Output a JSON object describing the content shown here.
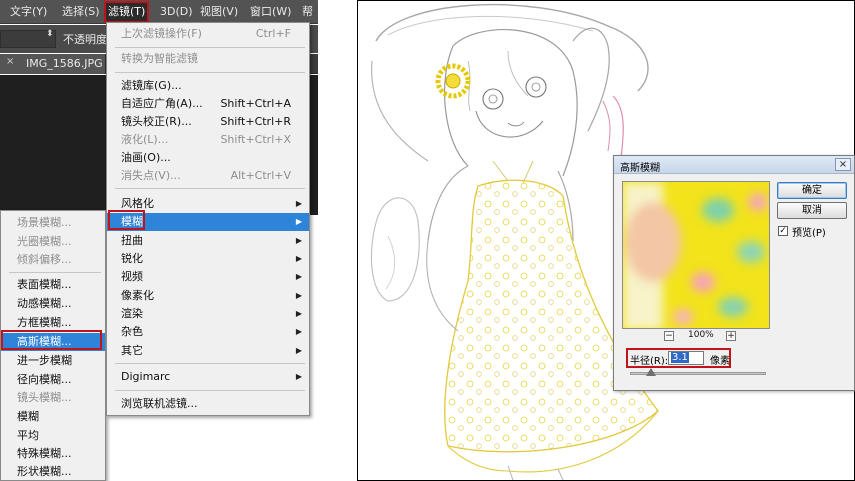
{
  "menubar": {
    "items": [
      "文字(Y)",
      "选择(S)",
      "滤镜(T)",
      "3D(D)",
      "视图(V)",
      "窗口(W)",
      "帮"
    ]
  },
  "options_bar": {
    "opacity_label": "不透明度"
  },
  "document_tab": {
    "close_glyph": "×",
    "title": "IMG_1586.JPG"
  },
  "filter_menu": {
    "items": [
      {
        "label": "上次滤镜操作(F)",
        "shortcut": "Ctrl+F",
        "disabled": true
      },
      {
        "label": "转换为智能滤镜",
        "shortcut": "",
        "disabled": true
      },
      {
        "label": "滤镜库(G)...",
        "shortcut": "",
        "disabled": false
      },
      {
        "label": "自适应广角(A)...",
        "shortcut": "Shift+Ctrl+A",
        "disabled": false
      },
      {
        "label": "镜头校正(R)...",
        "shortcut": "Shift+Ctrl+R",
        "disabled": false
      },
      {
        "label": "液化(L)...",
        "shortcut": "Shift+Ctrl+X",
        "disabled": true
      },
      {
        "label": "油画(O)...",
        "shortcut": "",
        "disabled": false
      },
      {
        "label": "消失点(V)...",
        "shortcut": "Alt+Ctrl+V",
        "disabled": true
      },
      {
        "label": "风格化",
        "shortcut": "",
        "disabled": false
      },
      {
        "label": "模糊",
        "shortcut": "",
        "disabled": false
      },
      {
        "label": "扭曲",
        "shortcut": "",
        "disabled": false
      },
      {
        "label": "锐化",
        "shortcut": "",
        "disabled": false
      },
      {
        "label": "视频",
        "shortcut": "",
        "disabled": false
      },
      {
        "label": "像素化",
        "shortcut": "",
        "disabled": false
      },
      {
        "label": "渲染",
        "shortcut": "",
        "disabled": false
      },
      {
        "label": "杂色",
        "shortcut": "",
        "disabled": false
      },
      {
        "label": "其它",
        "shortcut": "",
        "disabled": false
      },
      {
        "label": "Digimarc",
        "shortcut": "",
        "disabled": false
      },
      {
        "label": "浏览联机滤镜...",
        "shortcut": "",
        "disabled": false
      }
    ],
    "highlighted": "模糊"
  },
  "blur_submenu": {
    "items": [
      {
        "label": "场景模糊...",
        "disabled": true
      },
      {
        "label": "光圈模糊...",
        "disabled": true
      },
      {
        "label": "倾斜偏移...",
        "disabled": true
      },
      {
        "label": "表面模糊...",
        "disabled": false
      },
      {
        "label": "动感模糊...",
        "disabled": false
      },
      {
        "label": "方框模糊...",
        "disabled": false
      },
      {
        "label": "高斯模糊...",
        "disabled": false
      },
      {
        "label": "进一步模糊",
        "disabled": false
      },
      {
        "label": "径向模糊...",
        "disabled": false
      },
      {
        "label": "镜头模糊...",
        "disabled": true
      },
      {
        "label": "模糊",
        "disabled": false
      },
      {
        "label": "平均",
        "disabled": false
      },
      {
        "label": "特殊模糊...",
        "disabled": false
      },
      {
        "label": "形状模糊...",
        "disabled": false
      }
    ],
    "highlighted": "高斯模糊..."
  },
  "gaussian_dialog": {
    "title": "高斯模糊",
    "close_glyph": "×",
    "ok_label": "确定",
    "cancel_label": "取消",
    "preview_checked": true,
    "preview_label": "预览(P)",
    "zoom_out_glyph": "−",
    "zoom_in_glyph": "+",
    "zoom_value": "100%",
    "radius_label": "半径(R):",
    "radius_value": "3.1",
    "radius_unit": "像素"
  },
  "colors": {
    "highlight_blue": "#2e84d8",
    "annotation_red": "#c0141b",
    "dress_yellow": "#f5e400"
  }
}
